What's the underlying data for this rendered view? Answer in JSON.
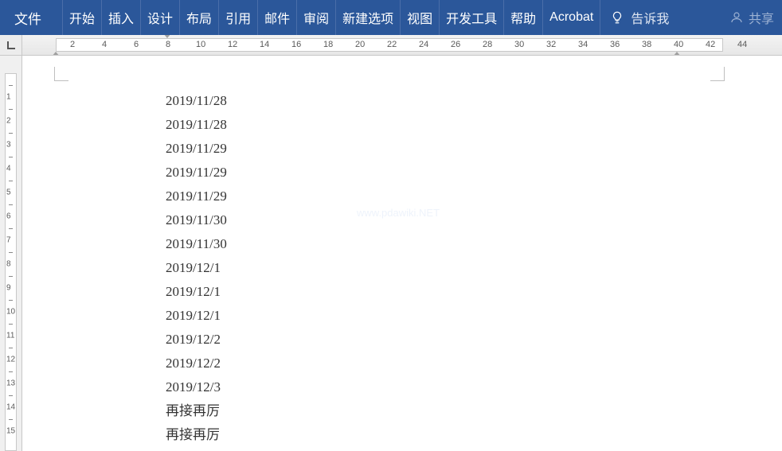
{
  "ribbon": {
    "file": "文件",
    "tabs": [
      "开始",
      "插入",
      "设计",
      "布局",
      "引用",
      "邮件",
      "审阅",
      "新建选项",
      "视图",
      "开发工具",
      "帮助",
      "Acrobat"
    ],
    "tellme": "告诉我",
    "share": "共享"
  },
  "hruler": {
    "numbers": [
      2,
      4,
      6,
      8,
      10,
      12,
      14,
      16,
      18,
      20,
      22,
      24,
      26,
      28,
      30,
      32,
      34,
      36,
      38,
      40,
      42,
      44
    ]
  },
  "vruler": {
    "numbers": [
      1,
      2,
      3,
      4,
      5,
      6,
      7,
      8,
      9,
      10,
      11,
      12,
      13,
      14,
      15
    ]
  },
  "document": {
    "lines": [
      "2019/11/28",
      "2019/11/28",
      "2019/11/29",
      "2019/11/29",
      "2019/11/29",
      "2019/11/30",
      "2019/11/30",
      "2019/12/1",
      "2019/12/1",
      "2019/12/1",
      "2019/12/2",
      "2019/12/2",
      "2019/12/3",
      "再接再厉",
      "再接再厉"
    ],
    "watermark": "www.pdawiki.NET"
  }
}
